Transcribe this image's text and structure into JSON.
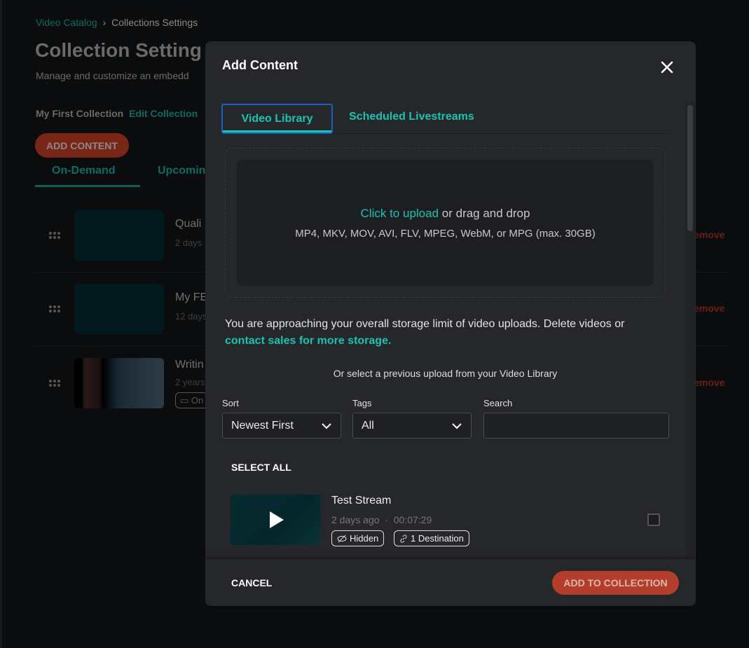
{
  "page": {
    "breadcrumb": {
      "parent": "Video Catalog",
      "separator": "›",
      "current": "Collections Settings"
    },
    "title": "Collection Setting",
    "subtitle": "Manage and customize an embedd",
    "collection_name": "My First Collection",
    "edit_collection": "Edit Collection",
    "add_content": "ADD CONTENT",
    "tabs": [
      {
        "label": "On-Demand",
        "active": true
      },
      {
        "label": "Upcomin"
      }
    ],
    "rows": [
      {
        "title": "Quali",
        "meta": "2 days",
        "action": "Remove"
      },
      {
        "title": "My FE",
        "meta": "12 days",
        "action": "Remove"
      },
      {
        "title": "Writin",
        "meta": "2 years",
        "badge": "On",
        "action": "Remove"
      }
    ]
  },
  "modal": {
    "title": "Add Content",
    "close_icon": "close-icon",
    "tabs": [
      {
        "label": "Video Library",
        "active": true
      },
      {
        "label": "Scheduled Livestreams"
      }
    ],
    "upload": {
      "link": "Click to upload",
      "rest": " or drag and drop",
      "formats": "MP4, MKV, MOV, AVI, FLV, MPEG, WebM, or MPG (max. 30GB)"
    },
    "warning": {
      "text": "You are approaching your overall storage limit of video uploads. Delete videos or ",
      "link": "contact sales for more storage."
    },
    "or_select": "Or select a previous upload from your Video Library",
    "filters": {
      "sort": {
        "label": "Sort",
        "value": "Newest First"
      },
      "tags": {
        "label": "Tags",
        "value": "All"
      },
      "search": {
        "label": "Search",
        "value": "",
        "placeholder": ""
      }
    },
    "select_all": "SELECT ALL",
    "items": [
      {
        "title": "Test Stream",
        "age": "2 days ago",
        "sep": "·",
        "duration": "00:07:29",
        "badges": [
          "Hidden",
          "1 Destination"
        ],
        "checked": false
      }
    ],
    "cancel": "CANCEL",
    "add_to_collection": "ADD TO COLLECTION"
  },
  "colors": {
    "accent": "#19c3b0",
    "danger": "#b23e2b",
    "modal_bg": "#26272b"
  }
}
